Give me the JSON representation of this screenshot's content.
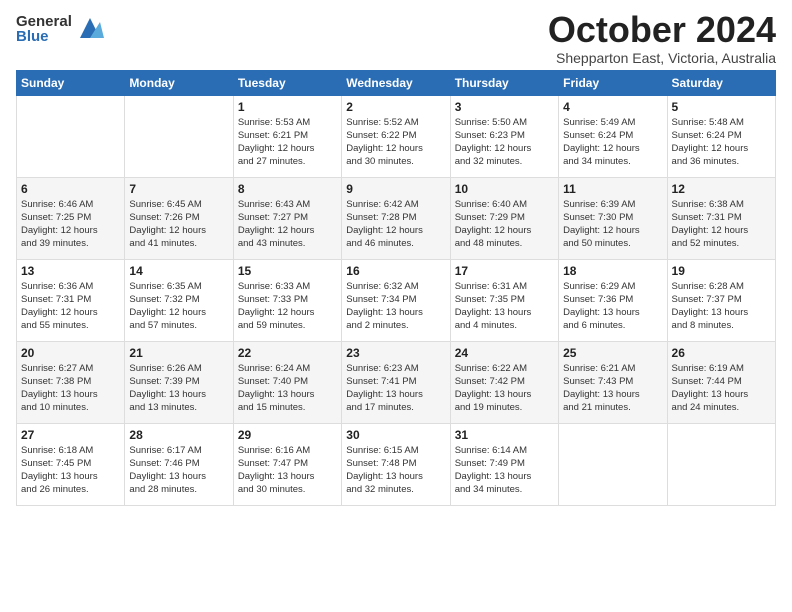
{
  "logo": {
    "general": "General",
    "blue": "Blue"
  },
  "title": {
    "month": "October 2024",
    "location": "Shepparton East, Victoria, Australia"
  },
  "weekdays": [
    "Sunday",
    "Monday",
    "Tuesday",
    "Wednesday",
    "Thursday",
    "Friday",
    "Saturday"
  ],
  "weeks": [
    [
      {
        "day": "",
        "info": ""
      },
      {
        "day": "",
        "info": ""
      },
      {
        "day": "1",
        "info": "Sunrise: 5:53 AM\nSunset: 6:21 PM\nDaylight: 12 hours\nand 27 minutes."
      },
      {
        "day": "2",
        "info": "Sunrise: 5:52 AM\nSunset: 6:22 PM\nDaylight: 12 hours\nand 30 minutes."
      },
      {
        "day": "3",
        "info": "Sunrise: 5:50 AM\nSunset: 6:23 PM\nDaylight: 12 hours\nand 32 minutes."
      },
      {
        "day": "4",
        "info": "Sunrise: 5:49 AM\nSunset: 6:24 PM\nDaylight: 12 hours\nand 34 minutes."
      },
      {
        "day": "5",
        "info": "Sunrise: 5:48 AM\nSunset: 6:24 PM\nDaylight: 12 hours\nand 36 minutes."
      }
    ],
    [
      {
        "day": "6",
        "info": "Sunrise: 6:46 AM\nSunset: 7:25 PM\nDaylight: 12 hours\nand 39 minutes."
      },
      {
        "day": "7",
        "info": "Sunrise: 6:45 AM\nSunset: 7:26 PM\nDaylight: 12 hours\nand 41 minutes."
      },
      {
        "day": "8",
        "info": "Sunrise: 6:43 AM\nSunset: 7:27 PM\nDaylight: 12 hours\nand 43 minutes."
      },
      {
        "day": "9",
        "info": "Sunrise: 6:42 AM\nSunset: 7:28 PM\nDaylight: 12 hours\nand 46 minutes."
      },
      {
        "day": "10",
        "info": "Sunrise: 6:40 AM\nSunset: 7:29 PM\nDaylight: 12 hours\nand 48 minutes."
      },
      {
        "day": "11",
        "info": "Sunrise: 6:39 AM\nSunset: 7:30 PM\nDaylight: 12 hours\nand 50 minutes."
      },
      {
        "day": "12",
        "info": "Sunrise: 6:38 AM\nSunset: 7:31 PM\nDaylight: 12 hours\nand 52 minutes."
      }
    ],
    [
      {
        "day": "13",
        "info": "Sunrise: 6:36 AM\nSunset: 7:31 PM\nDaylight: 12 hours\nand 55 minutes."
      },
      {
        "day": "14",
        "info": "Sunrise: 6:35 AM\nSunset: 7:32 PM\nDaylight: 12 hours\nand 57 minutes."
      },
      {
        "day": "15",
        "info": "Sunrise: 6:33 AM\nSunset: 7:33 PM\nDaylight: 12 hours\nand 59 minutes."
      },
      {
        "day": "16",
        "info": "Sunrise: 6:32 AM\nSunset: 7:34 PM\nDaylight: 13 hours\nand 2 minutes."
      },
      {
        "day": "17",
        "info": "Sunrise: 6:31 AM\nSunset: 7:35 PM\nDaylight: 13 hours\nand 4 minutes."
      },
      {
        "day": "18",
        "info": "Sunrise: 6:29 AM\nSunset: 7:36 PM\nDaylight: 13 hours\nand 6 minutes."
      },
      {
        "day": "19",
        "info": "Sunrise: 6:28 AM\nSunset: 7:37 PM\nDaylight: 13 hours\nand 8 minutes."
      }
    ],
    [
      {
        "day": "20",
        "info": "Sunrise: 6:27 AM\nSunset: 7:38 PM\nDaylight: 13 hours\nand 10 minutes."
      },
      {
        "day": "21",
        "info": "Sunrise: 6:26 AM\nSunset: 7:39 PM\nDaylight: 13 hours\nand 13 minutes."
      },
      {
        "day": "22",
        "info": "Sunrise: 6:24 AM\nSunset: 7:40 PM\nDaylight: 13 hours\nand 15 minutes."
      },
      {
        "day": "23",
        "info": "Sunrise: 6:23 AM\nSunset: 7:41 PM\nDaylight: 13 hours\nand 17 minutes."
      },
      {
        "day": "24",
        "info": "Sunrise: 6:22 AM\nSunset: 7:42 PM\nDaylight: 13 hours\nand 19 minutes."
      },
      {
        "day": "25",
        "info": "Sunrise: 6:21 AM\nSunset: 7:43 PM\nDaylight: 13 hours\nand 21 minutes."
      },
      {
        "day": "26",
        "info": "Sunrise: 6:19 AM\nSunset: 7:44 PM\nDaylight: 13 hours\nand 24 minutes."
      }
    ],
    [
      {
        "day": "27",
        "info": "Sunrise: 6:18 AM\nSunset: 7:45 PM\nDaylight: 13 hours\nand 26 minutes."
      },
      {
        "day": "28",
        "info": "Sunrise: 6:17 AM\nSunset: 7:46 PM\nDaylight: 13 hours\nand 28 minutes."
      },
      {
        "day": "29",
        "info": "Sunrise: 6:16 AM\nSunset: 7:47 PM\nDaylight: 13 hours\nand 30 minutes."
      },
      {
        "day": "30",
        "info": "Sunrise: 6:15 AM\nSunset: 7:48 PM\nDaylight: 13 hours\nand 32 minutes."
      },
      {
        "day": "31",
        "info": "Sunrise: 6:14 AM\nSunset: 7:49 PM\nDaylight: 13 hours\nand 34 minutes."
      },
      {
        "day": "",
        "info": ""
      },
      {
        "day": "",
        "info": ""
      }
    ]
  ]
}
